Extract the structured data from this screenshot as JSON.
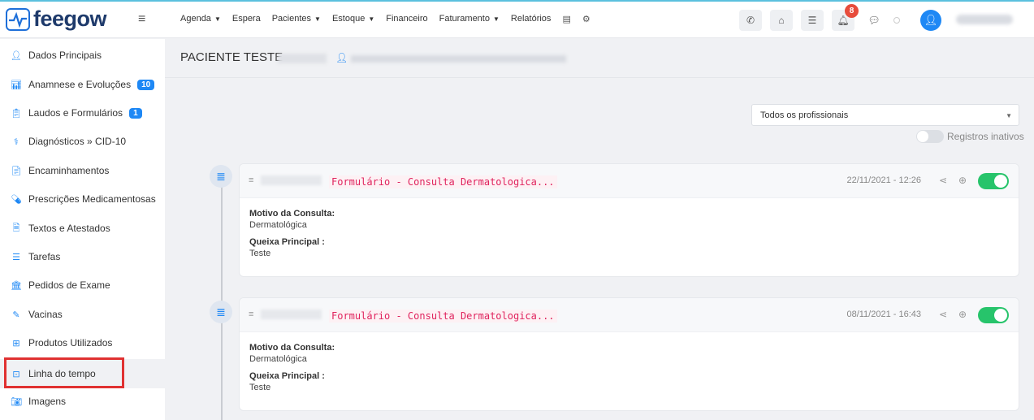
{
  "brand": {
    "name": "feegow",
    "accent": "#1e88f5"
  },
  "nav": {
    "items": [
      {
        "label": "Agenda",
        "dropdown": true
      },
      {
        "label": "Espera",
        "dropdown": false
      },
      {
        "label": "Pacientes",
        "dropdown": true
      },
      {
        "label": "Estoque",
        "dropdown": true
      },
      {
        "label": "Financeiro",
        "dropdown": false
      },
      {
        "label": "Faturamento",
        "dropdown": true
      },
      {
        "label": "Relatórios",
        "dropdown": false
      }
    ],
    "notification_count": "8"
  },
  "sidebar": {
    "items": [
      {
        "label": "Dados Principais",
        "icon": "user-icon",
        "badge": ""
      },
      {
        "label": "Anamnese e Evoluções",
        "icon": "chart-icon",
        "badge": "10"
      },
      {
        "label": "Laudos e Formulários",
        "icon": "clipboard-icon",
        "badge": "1"
      },
      {
        "label": "Diagnósticos » CID-10",
        "icon": "stethoscope-icon",
        "badge": ""
      },
      {
        "label": "Encaminhamentos",
        "icon": "document-icon",
        "badge": ""
      },
      {
        "label": "Prescrições Medicamentosas",
        "icon": "pills-icon",
        "badge": ""
      },
      {
        "label": "Textos e Atestados",
        "icon": "certificate-icon",
        "badge": ""
      },
      {
        "label": "Tarefas",
        "icon": "tasks-icon",
        "badge": ""
      },
      {
        "label": "Pedidos de Exame",
        "icon": "exam-icon",
        "badge": ""
      },
      {
        "label": "Vacinas",
        "icon": "syringe-icon",
        "badge": ""
      },
      {
        "label": "Produtos Utilizados",
        "icon": "box-icon",
        "badge": ""
      },
      {
        "label": "Linha do tempo",
        "icon": "timeline-icon",
        "badge": ""
      },
      {
        "label": "Imagens",
        "icon": "camera-icon",
        "badge": ""
      }
    ]
  },
  "page": {
    "title": "PACIENTE TESTE"
  },
  "filters": {
    "professional_select": "Todos os profissionais",
    "inactive_label": "Registros inativos"
  },
  "records": [
    {
      "title": "Formulário - Consulta Dermatologica...",
      "date": "22/11/2021 - 12:26",
      "fields": [
        {
          "label": "Motivo da Consulta:",
          "value": "Dermatológica"
        },
        {
          "label": "Queixa Principal :",
          "value": "Teste"
        }
      ]
    },
    {
      "title": "Formulário - Consulta Dermatologica...",
      "date": "08/11/2021 - 16:43",
      "fields": [
        {
          "label": "Motivo da Consulta:",
          "value": "Dermatológica"
        },
        {
          "label": "Queixa Principal :",
          "value": "Teste"
        }
      ]
    }
  ]
}
